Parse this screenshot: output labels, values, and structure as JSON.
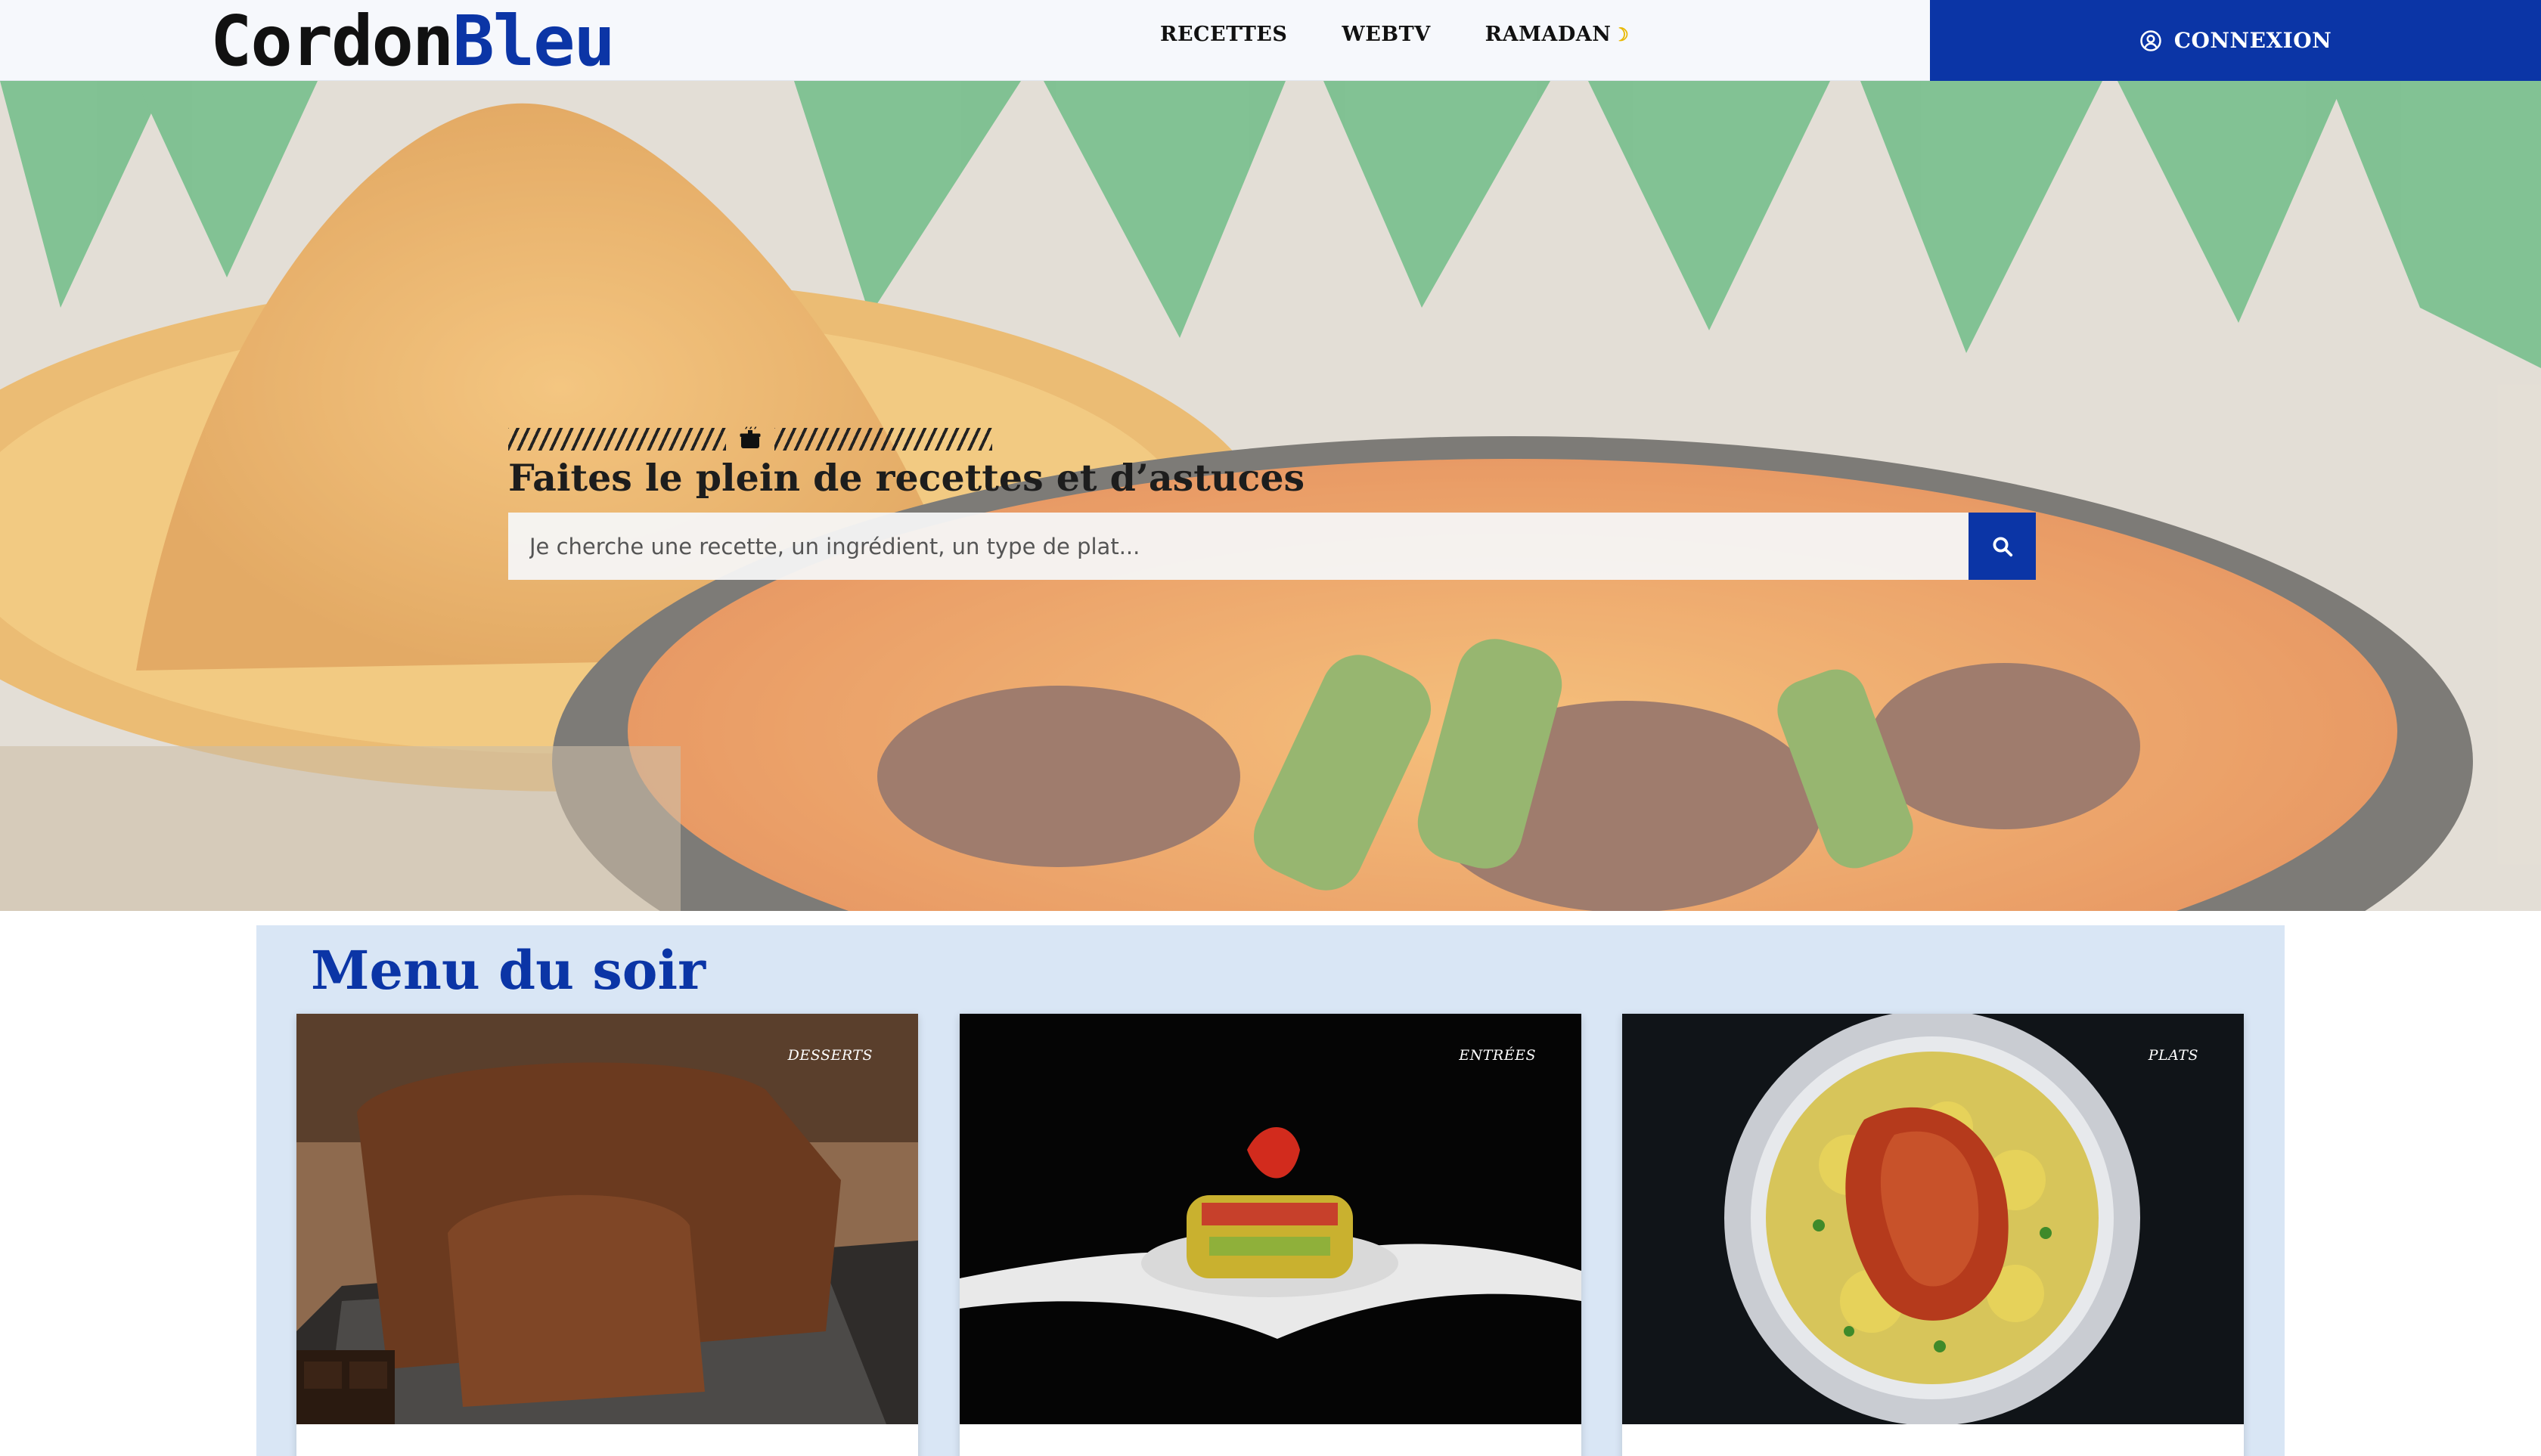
{
  "nav": {
    "logo_part1": "Cordon",
    "logo_part2": "Bleu",
    "links": [
      "RECETTES",
      "WEBTV",
      "RAMADAN"
    ],
    "login_label": "CONNEXION"
  },
  "hero": {
    "title": "Faites le plein de recettes et d’astuces",
    "search_placeholder": "Je cherche une recette, un ingrédient, un type de plat..."
  },
  "section": {
    "title": "Menu du soir",
    "cards": [
      {
        "category": "DESSERTS"
      },
      {
        "category": "ENTRÉES"
      },
      {
        "category": "PLATS"
      }
    ]
  },
  "colors": {
    "brand_blue": "#0b35a6",
    "panel_bg": "#d9e6f5",
    "nav_bg": "#f6f8fc"
  },
  "icons": [
    "user-circle-icon",
    "cooking-pot-icon",
    "search-icon",
    "crescent-moon-icon"
  ]
}
